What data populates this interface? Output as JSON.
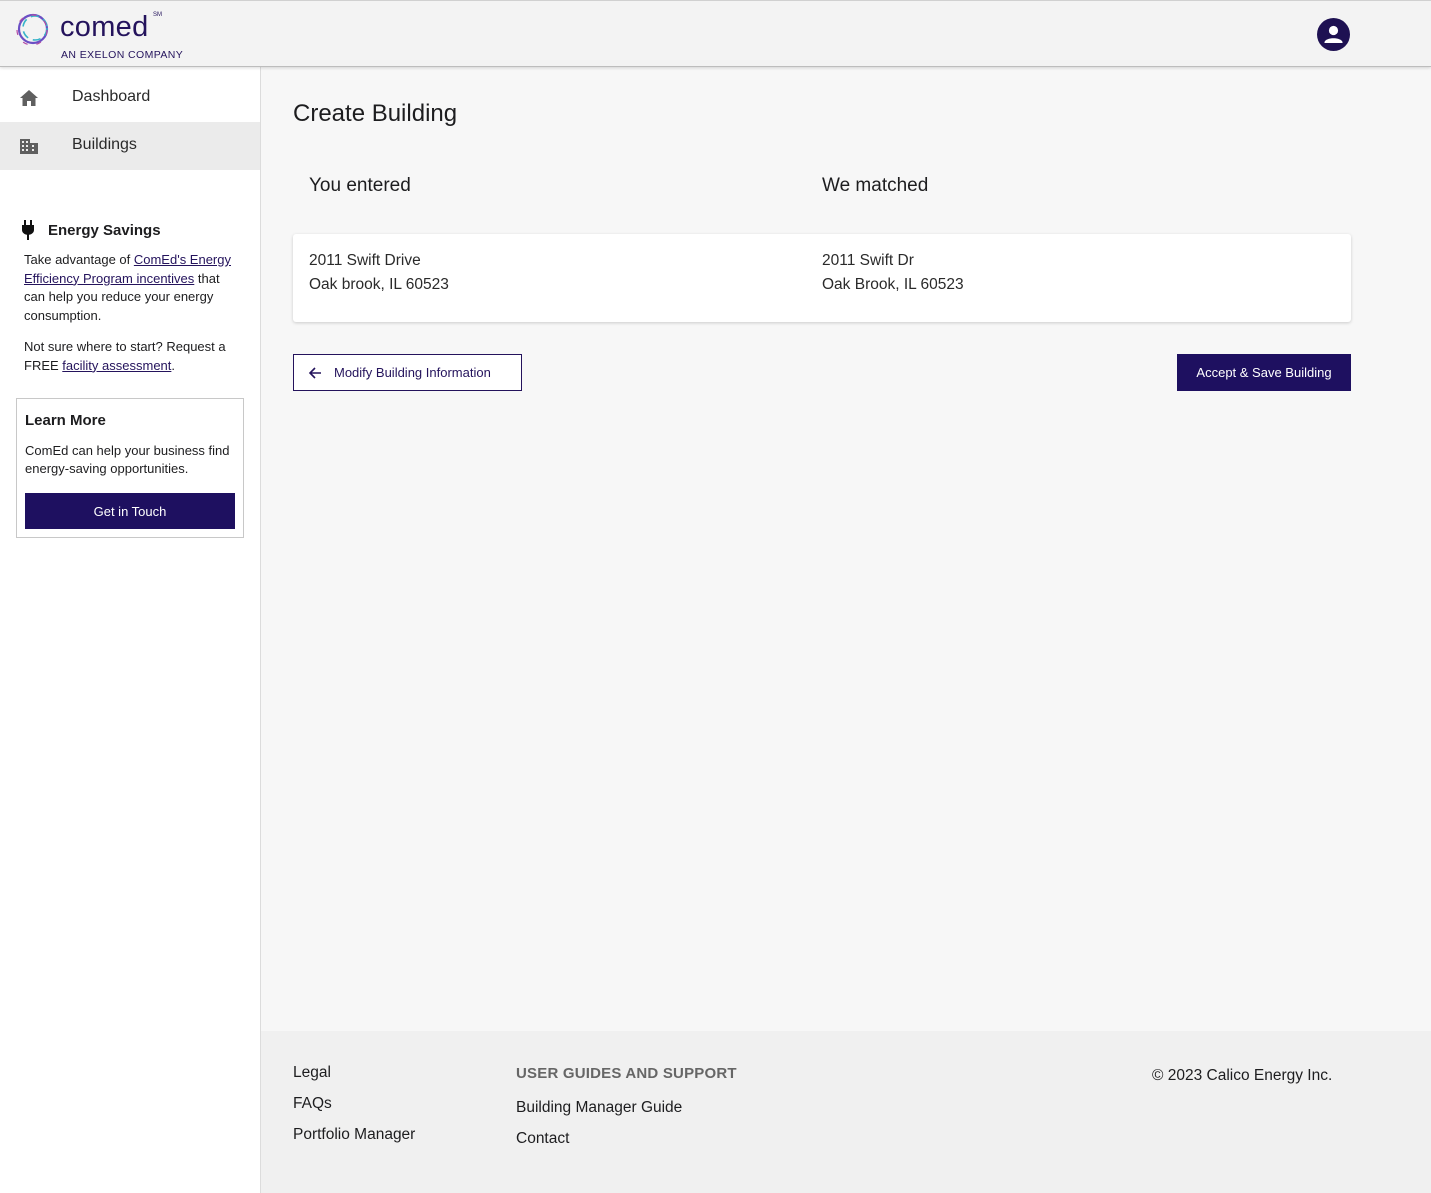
{
  "brand": {
    "logo_word": "comed",
    "logo_mark": "SM",
    "logo_sub": "AN EXELON COMPANY",
    "accent": "#1e1060"
  },
  "header": {
    "account_icon": "account-circle-icon"
  },
  "sidebar": {
    "items": [
      {
        "label": "Dashboard",
        "icon": "home-icon",
        "active": false
      },
      {
        "label": "Buildings",
        "icon": "building-icon",
        "active": true
      }
    ],
    "energy": {
      "title": "Energy Savings",
      "icon": "plug-icon",
      "p1_pre": "Take advantage of ",
      "p1_link": "ComEd's Energy Efficiency Program incentives",
      "p1_post": " that can help you reduce your energy consumption.",
      "p2_pre": "Not sure where to start? Request a FREE ",
      "p2_link": "facility assessment",
      "p2_post": "."
    },
    "learn_more": {
      "title": "Learn More",
      "text": "ComEd can help your business find energy-saving opportunities.",
      "button": "Get in Touch"
    }
  },
  "main": {
    "title": "Create Building",
    "entered": {
      "heading": "You entered",
      "line1": "2011 Swift Drive",
      "line2": "Oak brook, IL 60523"
    },
    "matched": {
      "heading": "We matched",
      "line1": "2011 Swift Dr",
      "line2": "Oak Brook, IL 60523"
    },
    "modify_button": "Modify Building Information",
    "accept_button": "Accept & Save Building"
  },
  "footer": {
    "links": [
      "Legal",
      "FAQs",
      "Portfolio Manager"
    ],
    "support_heading": "USER GUIDES AND SUPPORT",
    "support_links": [
      "Building Manager Guide",
      "Contact"
    ],
    "copyright": "© 2023 Calico Energy Inc."
  }
}
